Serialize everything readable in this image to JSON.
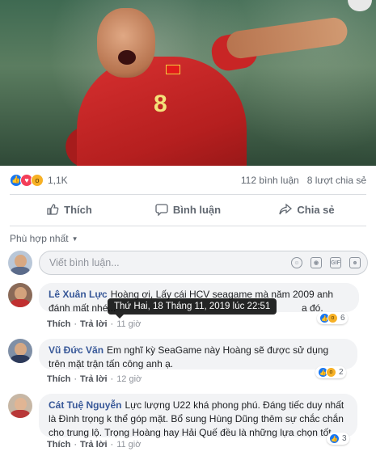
{
  "post": {
    "photo": {
      "jersey_number": "8"
    },
    "reactions": {
      "icons": [
        "like-icon",
        "love-icon",
        "wow-icon"
      ],
      "count": "1,1K"
    },
    "stats": {
      "comments": "112 bình luận",
      "shares": "8 lượt chia sẻ"
    },
    "actions": {
      "like": "Thích",
      "comment": "Bình luận",
      "share": "Chia sẻ"
    },
    "sort": {
      "label": "Phù hợp nhất"
    },
    "composer": {
      "placeholder": "Viết bình luận...",
      "tools": [
        "emoji-icon",
        "camera-icon",
        "gif-icon",
        "sticker-icon"
      ],
      "gif_label": "GIF"
    }
  },
  "comments": [
    {
      "author": "Lê Xuân Lực",
      "text": "Hoàng ơi, Lấy cái HCV seagame mà năm 2009 anh đánh mất nhé... ",
      "text_tail": "a đó.",
      "like": "Thích",
      "reply": "Trả lời",
      "time": "11 giờ",
      "reaction_count": "6"
    },
    {
      "author": "Vũ Đức Văn",
      "text": "Em nghĩ kỳ SeaGame này Hoàng sẽ được sử dụng trên mặt trận tấn công anh ạ.",
      "like": "Thích",
      "reply": "Trả lời",
      "time": "12 giờ",
      "reaction_count": "2"
    },
    {
      "author": "Cát Tuệ Nguyễn",
      "text": "Lực lượng U22 khá phong phú. Đáng tiếc duy nhất là Đình trọng k thể góp mặt. Bổ sung Hùng Dũng thêm sự chắc chắn cho trung lộ. Trọng Hoàng hay Hải Quế đều là những lựa chọn tốt.",
      "like": "Thích",
      "reply": "Trả lời",
      "time": "11 giờ",
      "reaction_count": "3"
    }
  ],
  "tooltip": {
    "text": "Thứ Hai, 18 Tháng 11, 2019 lúc 22:51"
  },
  "colors": {
    "accent": "#385898",
    "like_blue": "#1877f2",
    "love_red": "#f33e58",
    "wow_yellow": "#f7b125",
    "bubble": "#f2f3f5"
  }
}
